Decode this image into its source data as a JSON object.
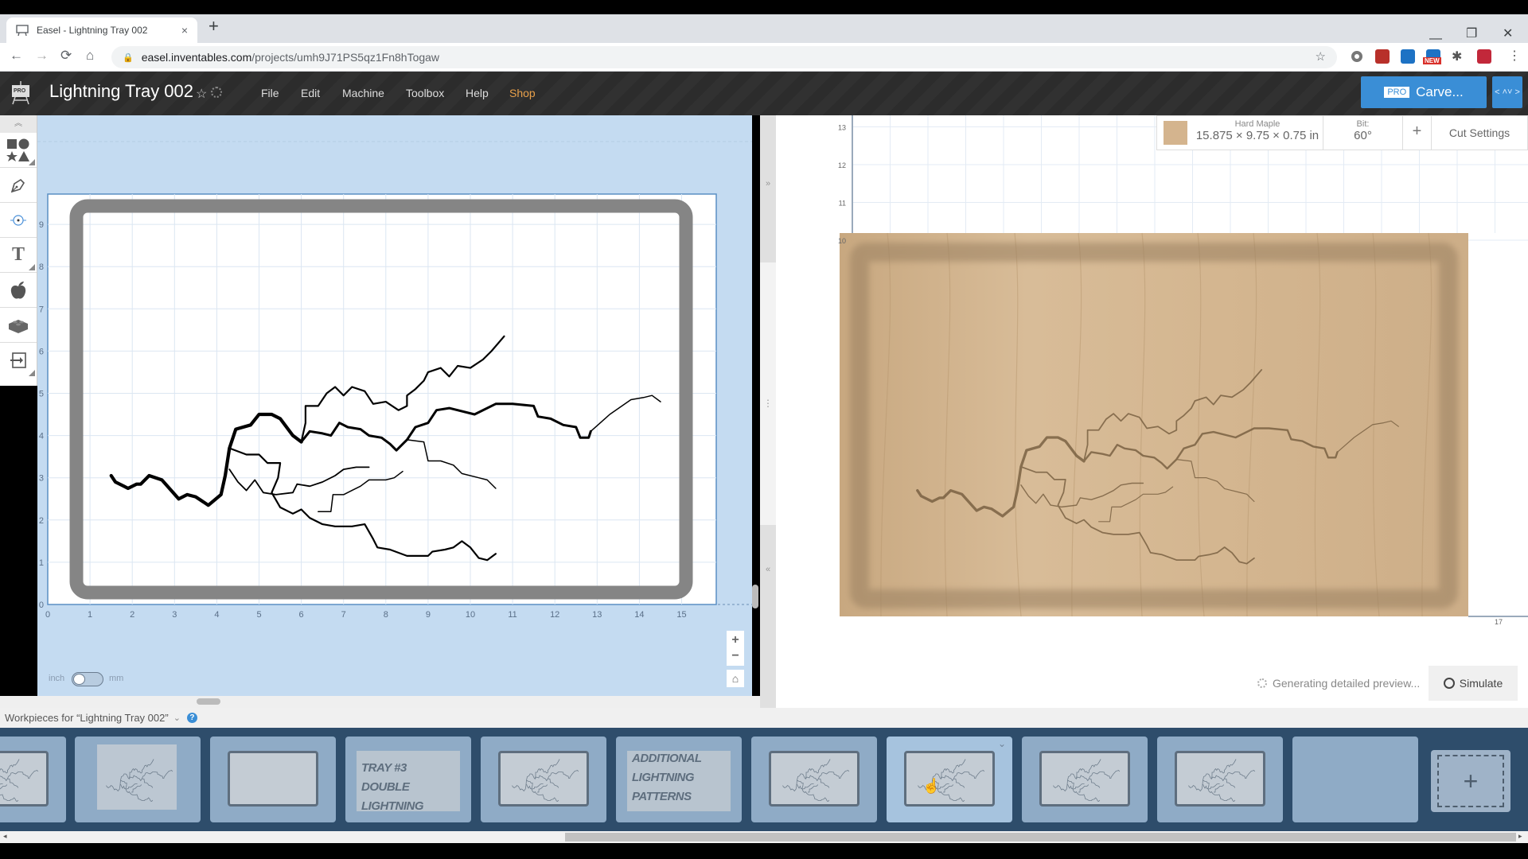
{
  "browser": {
    "tab_title": "Easel - Lightning Tray 002",
    "tab_close": "×",
    "new_tab": "+",
    "url_host": "easel.inventables.com",
    "url_path": "/projects/umh9J71PS5qz1Fn8hTogaw",
    "window_controls": {
      "minimize": "—",
      "maximize": "❐",
      "close": "✕"
    },
    "nav": {
      "back": "←",
      "forward": "→",
      "reload": "⟳",
      "home": "⌂"
    },
    "extensions": [
      "bookmark-star",
      "circle-ext",
      "chart-ext",
      "trello-ext",
      "new-ext",
      "puzzle-ext",
      "red-ext",
      "menu-dots"
    ],
    "ext_new_badge": "NEW"
  },
  "app": {
    "logo_badge": "PRO",
    "title": "Lightning Tray 002",
    "menu": [
      "File",
      "Edit",
      "Machine",
      "Toolbox",
      "Help",
      "Shop"
    ],
    "carve_badge": "PRO",
    "carve_label": "Carve...",
    "accent": "#3a8ed6",
    "shop_color": "#e8a04a"
  },
  "tools": [
    "shapes",
    "pen",
    "point",
    "text",
    "apple",
    "lego",
    "import"
  ],
  "design": {
    "x_ticks": [
      "0",
      "1",
      "2",
      "3",
      "4",
      "5",
      "6",
      "7",
      "8",
      "9",
      "10",
      "11",
      "12",
      "13",
      "14",
      "15"
    ],
    "y_ticks": [
      "0",
      "1",
      "2",
      "3",
      "4",
      "5",
      "6",
      "7",
      "8",
      "9"
    ],
    "unit_left": "inch",
    "unit_right": "mm",
    "unit_selected": "inch",
    "zoom_in": "+",
    "zoom_out": "−",
    "home": "⌂"
  },
  "preview": {
    "material_name": "Hard Maple",
    "material_dims": "15.875 × 9.75 × 0.75 in",
    "bit_label": "Bit:",
    "bit_value": "60°",
    "add_label": "+",
    "cut_settings": "Cut Settings",
    "y_ticks": [
      "10",
      "11",
      "12",
      "13"
    ],
    "x_tick_last": "17",
    "status": "Generating detailed preview...",
    "simulate": "Simulate"
  },
  "divider": {
    "expand": "»",
    "grip": "⋮",
    "collapse": "«"
  },
  "workpieces": {
    "label": "Workpieces for “Lightning Tray 002”",
    "chevron": "⌄",
    "help": "?",
    "thumbs": [
      {
        "kind": "frame-lightning",
        "active": false
      },
      {
        "kind": "lightning",
        "active": false
      },
      {
        "kind": "frame",
        "active": false
      },
      {
        "kind": "text",
        "text": [
          "TRAY #3",
          "DOUBLE LIGHTNING"
        ],
        "active": false
      },
      {
        "kind": "frame-lightning",
        "active": false
      },
      {
        "kind": "text",
        "text": [
          "ADDITIONAL",
          "LIGHTNING",
          "PATTERNS"
        ],
        "active": false
      },
      {
        "kind": "frame-lightning",
        "active": false
      },
      {
        "kind": "frame-lightning",
        "active": true
      },
      {
        "kind": "frame-lightning",
        "active": false
      },
      {
        "kind": "frame-lightning",
        "active": false
      },
      {
        "kind": "empty",
        "active": false
      }
    ],
    "add_label": "+"
  }
}
